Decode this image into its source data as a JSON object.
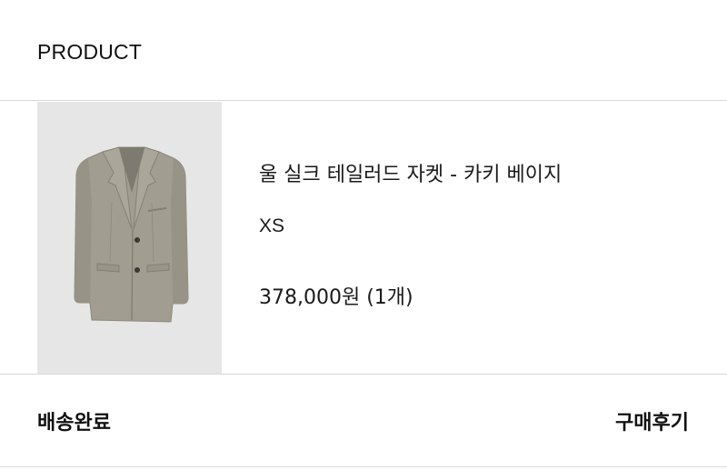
{
  "header": {
    "title": "PRODUCT"
  },
  "product": {
    "image_icon": "jacket-image",
    "name": "울 실크 테일러드 자켓 - 카키 베이지",
    "option": "XS",
    "price": "378,000원 (1개)"
  },
  "footer": {
    "status": "배송완료",
    "review_button": "구매후기"
  },
  "colors": {
    "divider": "#d9d9d9",
    "thumb_bg": "#e6e6e6",
    "jacket": "#9e9a8c"
  }
}
